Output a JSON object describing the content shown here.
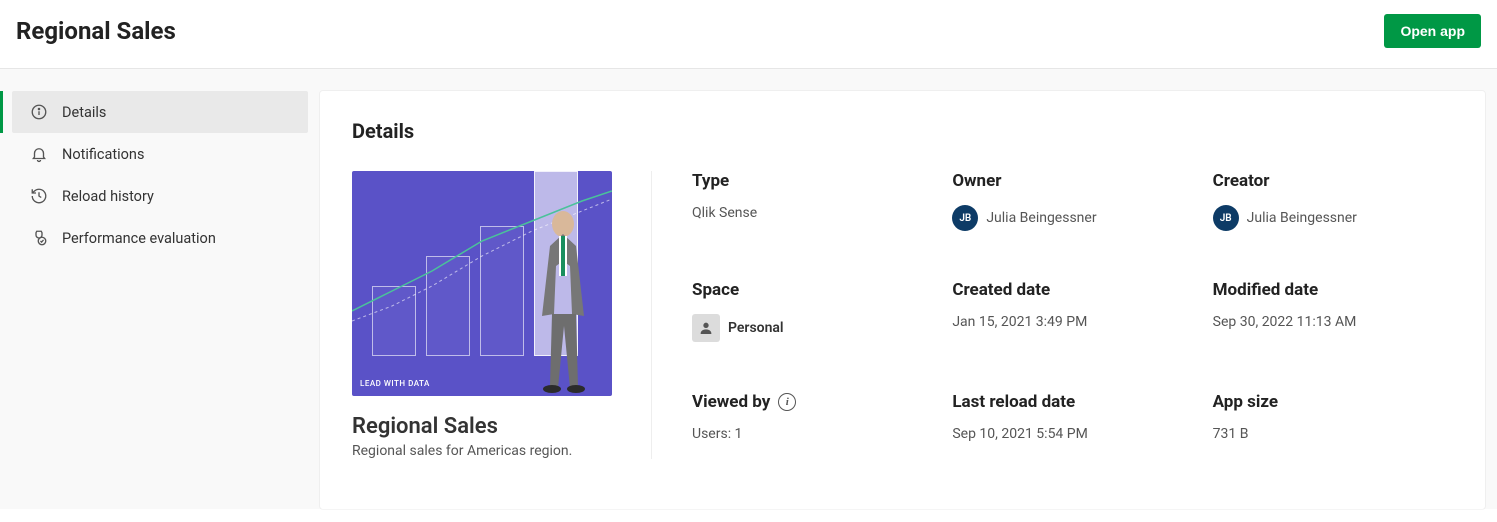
{
  "header": {
    "title": "Regional Sales",
    "open_app_label": "Open app"
  },
  "sidebar": {
    "items": [
      {
        "label": "Details"
      },
      {
        "label": "Notifications"
      },
      {
        "label": "Reload history"
      },
      {
        "label": "Performance evaluation"
      }
    ]
  },
  "main": {
    "section_title": "Details",
    "thumb_caption": "LEAD WITH DATA",
    "app_name": "Regional Sales",
    "app_desc": "Regional sales for Americas region.",
    "meta": {
      "type": {
        "label": "Type",
        "value": "Qlik Sense"
      },
      "owner": {
        "label": "Owner",
        "initials": "JB",
        "name": "Julia Beingessner"
      },
      "creator": {
        "label": "Creator",
        "initials": "JB",
        "name": "Julia Beingessner"
      },
      "space": {
        "label": "Space",
        "name": "Personal"
      },
      "created": {
        "label": "Created date",
        "value": "Jan 15, 2021 3:49 PM"
      },
      "modified": {
        "label": "Modified date",
        "value": "Sep 30, 2022 11:13 AM"
      },
      "viewed_by": {
        "label": "Viewed by",
        "value": "Users: 1"
      },
      "last_reload": {
        "label": "Last reload date",
        "value": "Sep 10, 2021 5:54 PM"
      },
      "app_size": {
        "label": "App size",
        "value": "731 B"
      }
    }
  }
}
